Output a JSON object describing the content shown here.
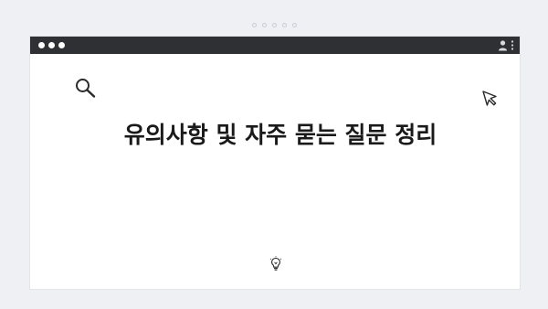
{
  "carousel": {
    "dot_count": 5
  },
  "window": {
    "titlebar_color": "#2e3034",
    "traffic_lights": [
      "window-dot",
      "window-dot",
      "window-dot"
    ],
    "icons": [
      "user-icon",
      "more-vertical-icon"
    ]
  },
  "content": {
    "headline": "유의사항 및 자주 묻는 질문 정리",
    "icons": [
      "search-icon",
      "cursor-icon",
      "lightbulb-icon"
    ]
  },
  "colors": {
    "background": "#eef0f4",
    "panel": "#ffffff",
    "titlebar": "#2e3034",
    "text": "#1a1a1a"
  }
}
